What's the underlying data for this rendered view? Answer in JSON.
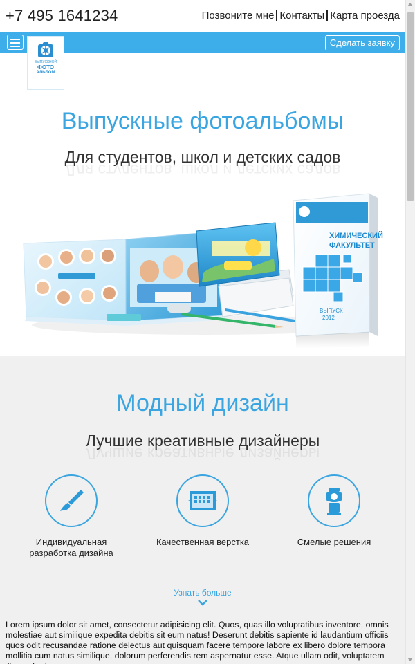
{
  "header": {
    "phone": "+7 495 1641234",
    "links": [
      "Позвоните мне",
      "Контакты",
      "Карта проезда"
    ]
  },
  "navbar": {
    "menu_icon": "hamburger-menu-icon",
    "cta_label": "Сделать заявку"
  },
  "logo": {
    "line1": "ВЫПУСКНОЙ",
    "line2": "ФОТО",
    "line3": "АЛЬБОМ"
  },
  "hero": {
    "title": "Выпускные фотоальбомы",
    "subtitle": "Для студентов, школ и детских садов",
    "book_text": {
      "cover_title_1": "ХИМИЧЕСКИЙ",
      "cover_title_2": "ФАКУЛЬТЕТ",
      "cover_year_1": "ВЫПУСК",
      "cover_year_2": "2012"
    }
  },
  "features": {
    "title": "Модный дизайн",
    "subtitle": "Лучшие креативные дизайнеры",
    "items": [
      {
        "label_1": "Индивидуальная",
        "label_2": "разработка дизайна",
        "icon": "paintbrush-icon"
      },
      {
        "label_1": "Качественная верстка",
        "label_2": "",
        "icon": "layout-grid-icon"
      },
      {
        "label_1": "Смелые решения",
        "label_2": "",
        "icon": "stamp-icon"
      }
    ],
    "more_label": "Узнать больше",
    "lorem": "Lorem ipsum dolor sit amet, consectetur adipisicing elit. Quos, quas illo voluptatibus inventore, omnis molestiae aut similique expedita debitis sit eum natus! Deserunt debitis sapiente id laudantium officiis quos odit recusandae ratione delectus aut quisquam facere tempore labore ex libero dolore tempora mollitia cum natus similique, dolorum perferendis rem aspernatur esse. Atque ullam odit, voluptatem illum, ab et"
  },
  "colors": {
    "accent": "#3daee9",
    "title_blue": "#3aa5e0",
    "section_bg": "#f0f0f0"
  }
}
